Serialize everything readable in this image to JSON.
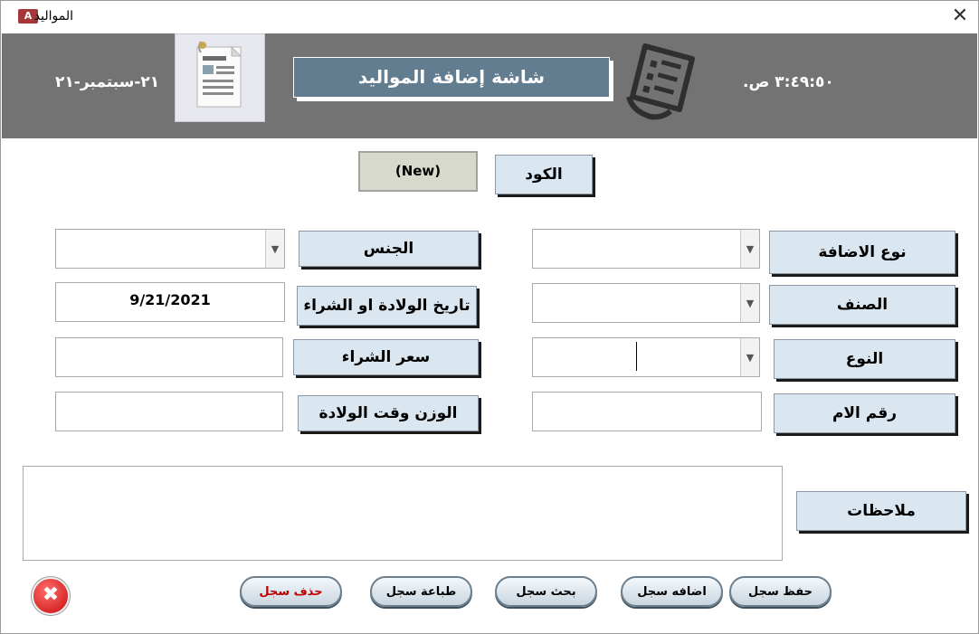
{
  "window": {
    "title": "المواليد",
    "app_icon_text": "A"
  },
  "header": {
    "date": "٢١-سبتمبر-٢١",
    "title": "شاشة إضافة المواليد",
    "time": ".٣:٤٩:٥٠ ص"
  },
  "form": {
    "code_label": "الكود",
    "code_value": "(New)",
    "addition_type_label": "نوع الاضافة",
    "addition_type_value": "",
    "category_label": "الصنف",
    "category_value": "",
    "type_label": "النوع",
    "type_value": "",
    "mother_number_label": "رقم الام",
    "mother_number_value": "",
    "gender_label": "الجنس",
    "gender_value": "",
    "birth_date_label": "تاريخ الولادة او الشراء",
    "birth_date_value": "9/21/2021",
    "purchase_price_label": "سعر الشراء",
    "purchase_price_value": "",
    "birth_weight_label": "الوزن وقت الولادة",
    "birth_weight_value": "",
    "notes_label": "ملاحظات",
    "notes_value": ""
  },
  "actions": {
    "save": "حفظ سجل",
    "add": "اضافه سجل",
    "search": "بحث سجل",
    "print": "طباعة سجل",
    "delete": "حذف سجل"
  },
  "icons": {
    "close": "close-icon",
    "exit": "exit-icon",
    "form": "form-document-icon",
    "list": "list-document-icon",
    "dropdown": "chevron-down-icon"
  },
  "colors": {
    "header_bg": "#737373",
    "title_box_bg": "#627d8f",
    "label_bg": "#dbe7f0",
    "code_bg": "#d6d9cc",
    "delete_text": "#c00000"
  }
}
